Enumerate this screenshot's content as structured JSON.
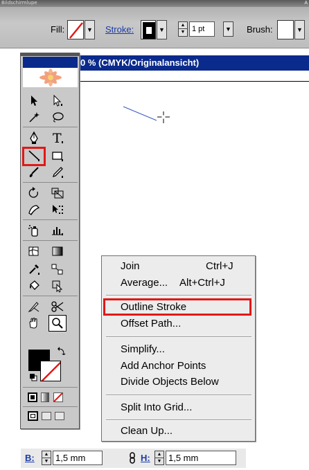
{
  "title_strip": {
    "text": "Bildschirmlupe",
    "right_mark": "A"
  },
  "control_bar": {
    "fill_label": "Fill:",
    "stroke_label": "Stroke:",
    "stroke_weight": "1 pt",
    "brush_label": "Brush:",
    "dropdown_glyph": "▼",
    "spin_up_glyph": "▲",
    "spin_down_glyph": "▼"
  },
  "document": {
    "title": "0 % (CMYK/Originalansicht)"
  },
  "tools_panel": {
    "tools": [
      "selection-tool",
      "direct-selection-tool",
      "magic-wand-tool",
      "lasso-tool",
      "pen-tool",
      "type-tool",
      "line-segment-tool",
      "rectangle-tool",
      "paintbrush-tool",
      "pencil-tool",
      "rotate-tool",
      "scale-tool",
      "warp-tool",
      "free-transform-tool",
      "symbol-sprayer-tool",
      "column-graph-tool",
      "mesh-tool",
      "gradient-tool",
      "eyedropper-tool",
      "blend-tool",
      "live-paint-bucket-tool",
      "live-paint-selection-tool",
      "slice-tool",
      "scissors-tool",
      "hand-tool",
      "zoom-tool"
    ],
    "selected_tool": "line-segment-tool"
  },
  "context_menu": {
    "items": [
      {
        "label": "Join",
        "shortcut": "Ctrl+J"
      },
      {
        "label": "Average...",
        "shortcut": "Alt+Ctrl+J"
      },
      {
        "label": "Outline Stroke",
        "shortcut": ""
      },
      {
        "label": "Offset Path...",
        "shortcut": ""
      },
      {
        "label": "Simplify...",
        "shortcut": ""
      },
      {
        "label": "Add Anchor Points",
        "shortcut": ""
      },
      {
        "label": "Divide Objects Below",
        "shortcut": ""
      },
      {
        "label": "Split Into Grid...",
        "shortcut": ""
      },
      {
        "label": "Clean Up...",
        "shortcut": ""
      }
    ],
    "highlighted_item": "Outline Stroke"
  },
  "bottom_bar": {
    "width_label": "B:",
    "width_value": "1,5 mm",
    "height_label": "H:",
    "height_value": "1,5 mm"
  },
  "colors": {
    "highlight_red": "#e01818",
    "title_blue": "#0a2a8c",
    "label_blue": "#1a3aa8"
  }
}
